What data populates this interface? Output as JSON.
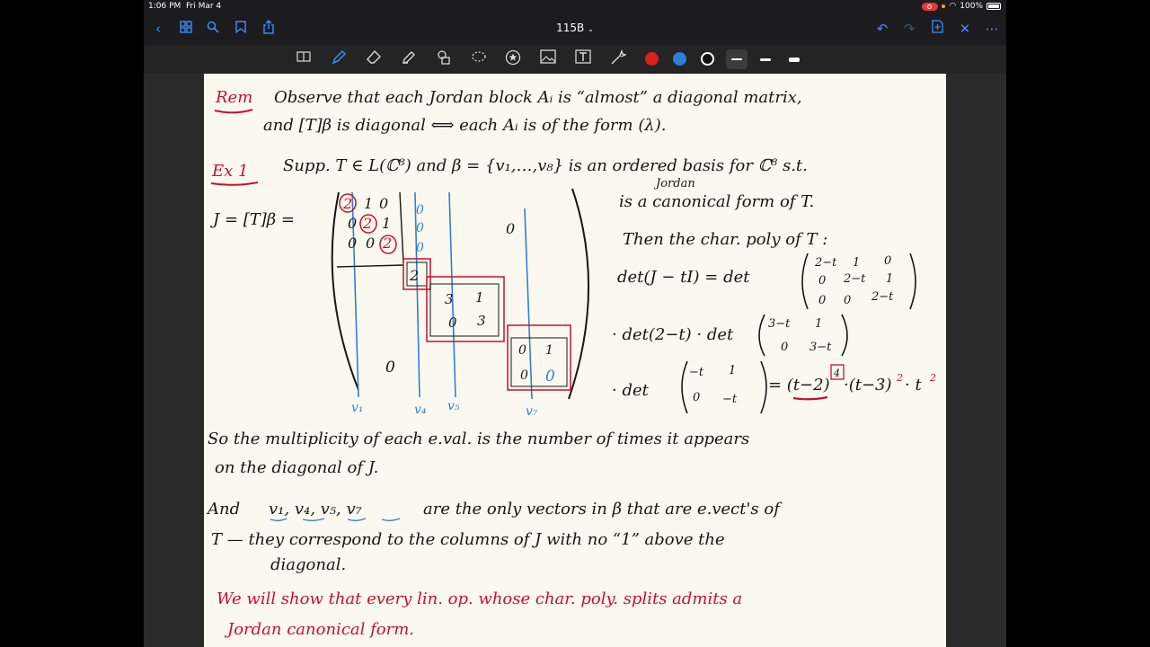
{
  "status": {
    "time": "1:06 PM",
    "date": "Fri Mar 4",
    "battery": "100%"
  },
  "nav": {
    "title": "115B"
  },
  "colors": {
    "accent": "#3a8dff",
    "ink_black": "#161616",
    "ink_red": "#c8102e",
    "ink_blue": "#2f7fd8"
  },
  "toolbar": {
    "colors": [
      "#e01e1e",
      "#2f7fd8",
      "#111111"
    ]
  },
  "note": {
    "rem": {
      "label": "Rem",
      "line1": "Observe that each Jordan block Aᵢ is “almost” a diagonal matrix,",
      "line2": "and [T]β is diagonal ⟺ each Aᵢ is of the form (λ)."
    },
    "ex": {
      "label": "Ex 1",
      "line1": "Supp. T ∈ L(ℂ⁸) and β = {v₁,…,v₈} is an ordered basis for ℂ⁸ s.t.",
      "jordan": "Jordan",
      "line2": "is a canonical form of T.",
      "line3": "Then the char. poly of T :",
      "jdef": "J = [T]β ="
    },
    "matrix": {
      "b1": [
        [
          "2",
          "1",
          "0"
        ],
        [
          "0",
          "2",
          "1"
        ],
        [
          "0",
          "0",
          "2"
        ]
      ],
      "b2": "2",
      "b3": [
        [
          "3",
          "1"
        ],
        [
          "0",
          "3"
        ]
      ],
      "b4": [
        [
          "0",
          "1"
        ],
        [
          "0",
          "0"
        ]
      ],
      "zero_top": "0",
      "zero_bottom": "0",
      "vecs": [
        "v₁",
        "v₄",
        "v₅",
        "v₇"
      ]
    },
    "det": {
      "row1_lhs": "det(J − tI) = det",
      "m1": [
        [
          "2−t",
          "1",
          "0"
        ],
        [
          "0",
          "2−t",
          "1"
        ],
        [
          "0",
          "0",
          "2−t"
        ]
      ],
      "row2_lhs": "· det(2−t) · det",
      "m2": [
        [
          "3−t",
          "1"
        ],
        [
          "0",
          "3−t"
        ]
      ],
      "row3_lhs": "· det",
      "m3": [
        [
          "−t",
          "1"
        ],
        [
          "0",
          "−t"
        ]
      ],
      "result": "= (t−2)",
      "exp4": "4",
      "result2": "·(t−3)",
      "exp2a": "2",
      "result3": "· t",
      "exp2b": "2"
    },
    "para1": {
      "line1": "So the multiplicity of each e.val. is the number of times it appears",
      "line2": "on the diagonal of J."
    },
    "para2": {
      "line1a": "And",
      "vecs": "v₁, v₄, v₅, v₇",
      "line1b": "are the only vectors in β that are e.vect's of",
      "line2": "T — they correspond to the columns of J with no “1” above the",
      "line3": "diagonal."
    },
    "closing": {
      "line1": "We will show that every lin. op. whose char. poly. splits admits a",
      "line2": "Jordan canonical form."
    }
  }
}
